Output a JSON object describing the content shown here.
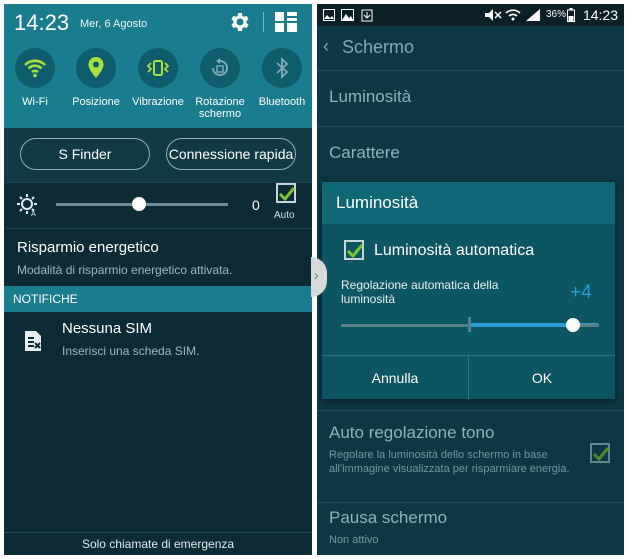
{
  "left": {
    "status": {
      "time": "14:23",
      "date": "Mer, 6 Agosto"
    },
    "toggles": [
      {
        "label": "Wi-Fi",
        "icon": "wifi-icon"
      },
      {
        "label": "Posizione",
        "icon": "location-icon"
      },
      {
        "label": "Vibrazione",
        "icon": "vibration-icon"
      },
      {
        "label": "Rotazione schermo",
        "icon": "rotation-icon"
      },
      {
        "label": "Bluetooth",
        "icon": "bluetooth-icon"
      }
    ],
    "buttons": {
      "finder": "S Finder",
      "quick_connect": "Connessione rapida"
    },
    "brightness": {
      "value": "0",
      "level": 0.48,
      "auto_label": "Auto"
    },
    "power_saving": {
      "title": "Risparmio energetico",
      "subtitle": "Modalità di risparmio energetico attivata."
    },
    "notifications": {
      "header": "NOTIFICHE",
      "items": [
        {
          "title": "Nessuna SIM",
          "subtitle": "Inserisci una scheda SIM."
        }
      ]
    },
    "emergency": "Solo chiamate di emergenza"
  },
  "right": {
    "status": {
      "time": "14:23",
      "battery": "36%"
    },
    "appbar": {
      "title": "Schermo"
    },
    "items": [
      {
        "title": "Luminosità"
      },
      {
        "title": "Carattere"
      },
      {
        "title": "Auto regolazione tono",
        "subtitle": "Regolare la luminosità dello schermo in base all'immagine visualizzata per risparmiare energia."
      },
      {
        "title": "Pausa schermo",
        "subtitle": "Non attivo"
      }
    ],
    "dialog": {
      "title": "Luminosità",
      "auto_label": "Luminosità automatica",
      "adjust_label": "Regolazione automatica della luminosità",
      "value": "+4",
      "cancel": "Annulla",
      "ok": "OK"
    }
  },
  "colors": {
    "teal_header": "#1a7d8f",
    "toggle_active": "#a8e03a",
    "check_green": "#7cc42a",
    "accent_blue": "#2b9dd6"
  }
}
